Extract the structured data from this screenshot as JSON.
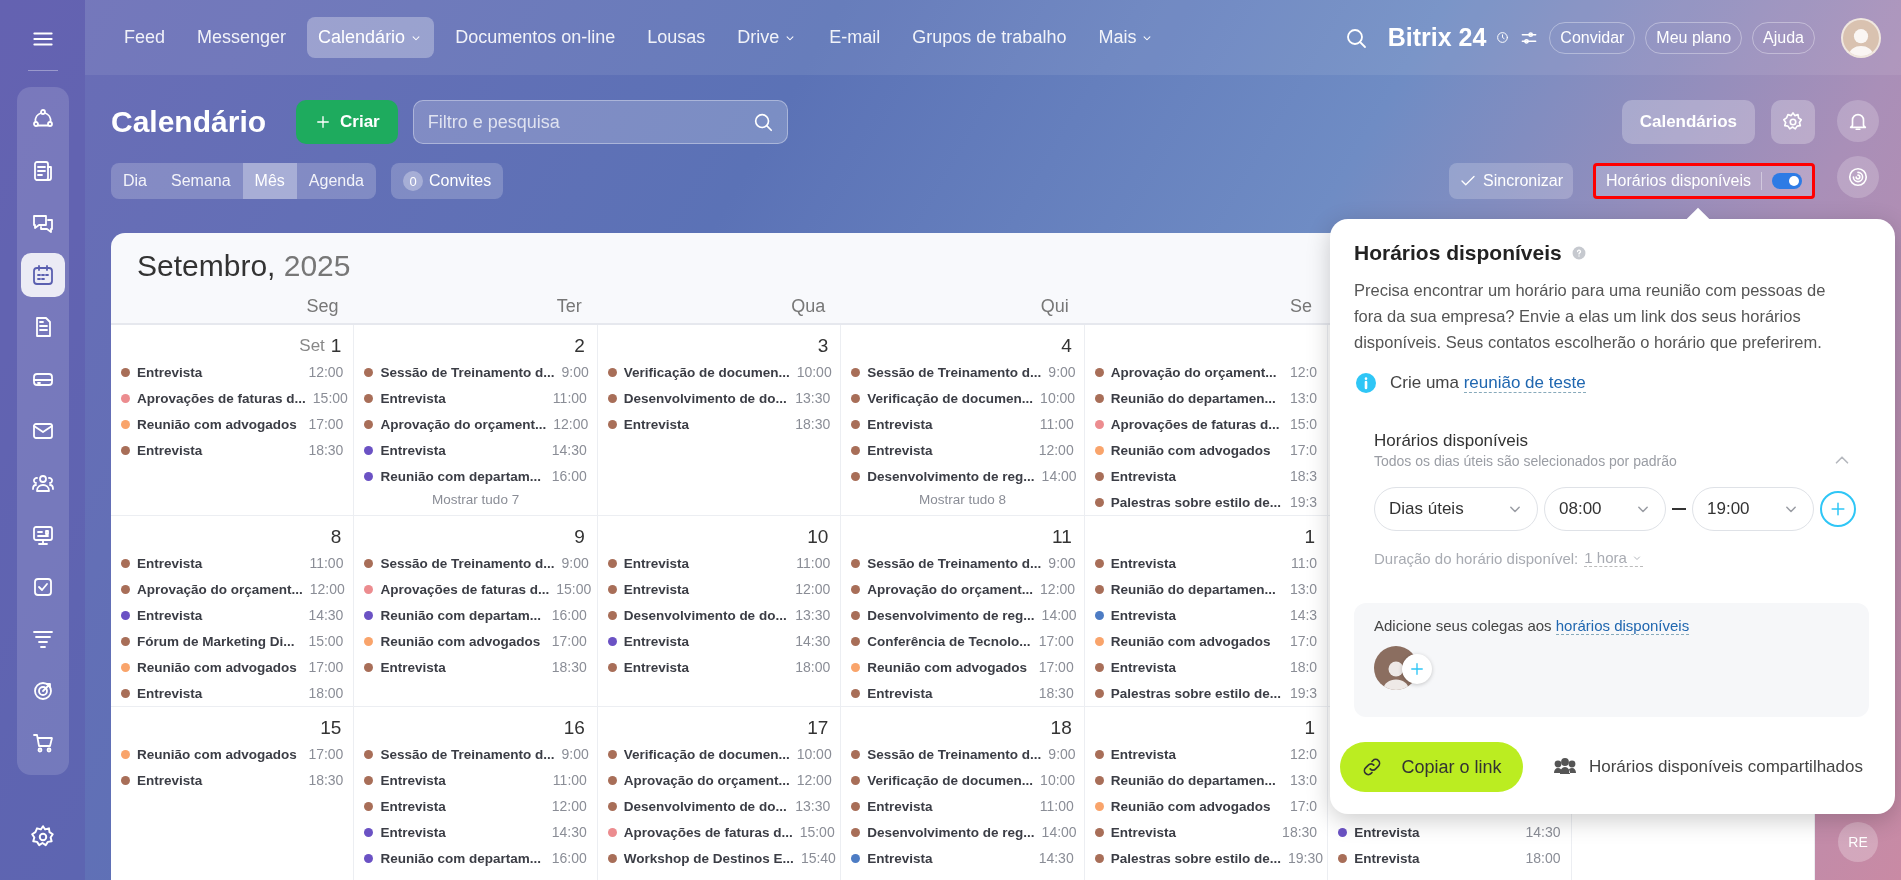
{
  "sidebar": {
    "items": [
      {
        "selected": false
      },
      {
        "selected": false
      },
      {
        "selected": false
      },
      {
        "selected": true
      },
      {
        "selected": false
      },
      {
        "selected": false
      },
      {
        "selected": false
      },
      {
        "selected": false
      },
      {
        "selected": false
      },
      {
        "selected": false
      },
      {
        "selected": false
      },
      {
        "selected": false
      },
      {
        "selected": false
      }
    ]
  },
  "nav": [
    {
      "label": "Feed",
      "selected": false,
      "dropdown": false
    },
    {
      "label": "Messenger",
      "selected": false,
      "dropdown": false
    },
    {
      "label": "Calendário",
      "selected": true,
      "dropdown": true
    },
    {
      "label": "Documentos on-line",
      "selected": false,
      "dropdown": false
    },
    {
      "label": "Lousas",
      "selected": false,
      "dropdown": false
    },
    {
      "label": "Drive",
      "selected": false,
      "dropdown": true
    },
    {
      "label": "E-mail",
      "selected": false,
      "dropdown": false
    },
    {
      "label": "Grupos de trabalho",
      "selected": false,
      "dropdown": false
    },
    {
      "label": "Mais",
      "selected": false,
      "dropdown": true
    }
  ],
  "topbar": {
    "logo": "Bitrix 24",
    "buttons": [
      "Convidar",
      "Meu plano",
      "Ajuda"
    ]
  },
  "page": {
    "title": "Calendário",
    "create": "Criar",
    "search_placeholder": "Filtro e pesquisa",
    "calendars_button": "Calendários"
  },
  "views": [
    {
      "label": "Dia",
      "selected": false
    },
    {
      "label": "Semana",
      "selected": false
    },
    {
      "label": "Mês",
      "selected": true
    },
    {
      "label": "Agenda",
      "selected": false
    }
  ],
  "invites": {
    "count": "0",
    "label": "Convites"
  },
  "sync": "Sincronizar",
  "availability_toggle": {
    "label": "Horários disponíveis",
    "on": true,
    "highlighted": true
  },
  "calendar": {
    "month": "Setembro,",
    "year": "2025",
    "weekdays": [
      "Seg",
      "Ter",
      "Qua",
      "Qui",
      "Se"
    ],
    "weeks": [
      {
        "days": [
          {
            "month_label": "Set",
            "day": "1",
            "events": [
              {
                "title": "Entrevista",
                "time": "12:00",
                "color": "#a86e58"
              },
              {
                "title": "Aprovações de faturas d...",
                "time": "15:00",
                "color": "#ec8c8f"
              },
              {
                "title": "Reunião com advogados",
                "time": "17:00",
                "color": "#f9a46b"
              },
              {
                "title": "Entrevista",
                "time": "18:30",
                "color": "#a86e58"
              }
            ]
          },
          {
            "day": "2",
            "events": [
              {
                "title": "Sessão de Treinamento d...",
                "time": "9:00",
                "color": "#a86e58"
              },
              {
                "title": "Entrevista",
                "time": "11:00",
                "color": "#a86e58"
              },
              {
                "title": "Aprovação do orçament...",
                "time": "12:00",
                "color": "#a86e58"
              },
              {
                "title": "Entrevista",
                "time": "14:30",
                "color": "#6b52c4"
              },
              {
                "title": "Reunião com departam...",
                "time": "16:00",
                "color": "#6b52c4"
              }
            ],
            "more": "Mostrar tudo 7"
          },
          {
            "day": "3",
            "events": [
              {
                "title": "Verificação de documen...",
                "time": "10:00",
                "color": "#a86e58"
              },
              {
                "title": "Desenvolvimento de do...",
                "time": "13:30",
                "color": "#a86e58"
              },
              {
                "title": "Entrevista",
                "time": "18:30",
                "color": "#a86e58"
              }
            ]
          },
          {
            "day": "4",
            "events": [
              {
                "title": "Sessão de Treinamento d...",
                "time": "9:00",
                "color": "#a86e58"
              },
              {
                "title": "Verificação de documen...",
                "time": "10:00",
                "color": "#a86e58"
              },
              {
                "title": "Entrevista",
                "time": "11:00",
                "color": "#a86e58"
              },
              {
                "title": "Entrevista",
                "time": "12:00",
                "color": "#a86e58"
              },
              {
                "title": "Desenvolvimento de reg...",
                "time": "14:00",
                "color": "#a86e58"
              }
            ],
            "more": "Mostrar tudo 8"
          },
          {
            "events": [
              {
                "title": "Aprovação do orçament...",
                "time": "12:0",
                "color": "#a86e58"
              },
              {
                "title": "Reunião do departamen...",
                "time": "13:0",
                "color": "#a86e58"
              },
              {
                "title": "Aprovações de faturas d...",
                "time": "15:0",
                "color": "#ec8c8f"
              },
              {
                "title": "Reunião com advogados",
                "time": "17:0",
                "color": "#f9a46b"
              },
              {
                "title": "Entrevista",
                "time": "18:3",
                "color": "#a86e58"
              },
              {
                "title": "Palestras sobre estilo de...",
                "time": "19:3",
                "color": "#a86e58"
              }
            ]
          }
        ]
      },
      {
        "days": [
          {
            "day": "8",
            "events": [
              {
                "title": "Entrevista",
                "time": "11:00",
                "color": "#a86e58"
              },
              {
                "title": "Aprovação do orçament...",
                "time": "12:00",
                "color": "#a86e58"
              },
              {
                "title": "Entrevista",
                "time": "14:30",
                "color": "#6b52c4"
              },
              {
                "title": "Fórum de Marketing Di...",
                "time": "15:00",
                "color": "#a86e58"
              },
              {
                "title": "Reunião com advogados",
                "time": "17:00",
                "color": "#f9a46b"
              },
              {
                "title": "Entrevista",
                "time": "18:00",
                "color": "#a86e58"
              }
            ]
          },
          {
            "day": "9",
            "events": [
              {
                "title": "Sessão de Treinamento d...",
                "time": "9:00",
                "color": "#a86e58"
              },
              {
                "title": "Aprovações de faturas d...",
                "time": "15:00",
                "color": "#ec8c8f"
              },
              {
                "title": "Reunião com departam...",
                "time": "16:00",
                "color": "#6b52c4"
              },
              {
                "title": "Reunião com advogados",
                "time": "17:00",
                "color": "#f9a46b"
              },
              {
                "title": "Entrevista",
                "time": "18:30",
                "color": "#a86e58"
              }
            ]
          },
          {
            "day": "10",
            "events": [
              {
                "title": "Entrevista",
                "time": "11:00",
                "color": "#a86e58"
              },
              {
                "title": "Entrevista",
                "time": "12:00",
                "color": "#a86e58"
              },
              {
                "title": "Desenvolvimento de do...",
                "time": "13:30",
                "color": "#a86e58"
              },
              {
                "title": "Entrevista",
                "time": "14:30",
                "color": "#6b52c4"
              },
              {
                "title": "Entrevista",
                "time": "18:00",
                "color": "#a86e58"
              }
            ]
          },
          {
            "day": "11",
            "events": [
              {
                "title": "Sessão de Treinamento d...",
                "time": "9:00",
                "color": "#a86e58"
              },
              {
                "title": "Aprovação do orçament...",
                "time": "12:00",
                "color": "#a86e58"
              },
              {
                "title": "Desenvolvimento de reg...",
                "time": "14:00",
                "color": "#a86e58"
              },
              {
                "title": "Conferência de Tecnolo...",
                "time": "17:00",
                "color": "#a86e58"
              },
              {
                "title": "Reunião com advogados",
                "time": "17:00",
                "color": "#f9a46b"
              },
              {
                "title": "Entrevista",
                "time": "18:30",
                "color": "#a86e58"
              }
            ]
          },
          {
            "day": "1",
            "events": [
              {
                "title": "Entrevista",
                "time": "11:0",
                "color": "#a86e58"
              },
              {
                "title": "Reunião do departamen...",
                "time": "13:0",
                "color": "#a86e58"
              },
              {
                "title": "Entrevista",
                "time": "14:3",
                "color": "#4d7cc4"
              },
              {
                "title": "Reunião com advogados",
                "time": "17:0",
                "color": "#f9a46b"
              },
              {
                "title": "Entrevista",
                "time": "18:0",
                "color": "#a86e58"
              },
              {
                "title": "Palestras sobre estilo de...",
                "time": "19:3",
                "color": "#a86e58"
              }
            ]
          }
        ]
      },
      {
        "days": [
          {
            "day": "15",
            "events": [
              {
                "title": "Reunião com advogados",
                "time": "17:00",
                "color": "#f9a46b"
              },
              {
                "title": "Entrevista",
                "time": "18:30",
                "color": "#a86e58"
              }
            ]
          },
          {
            "day": "16",
            "events": [
              {
                "title": "Sessão de Treinamento d...",
                "time": "9:00",
                "color": "#a86e58"
              },
              {
                "title": "Entrevista",
                "time": "11:00",
                "color": "#a86e58"
              },
              {
                "title": "Entrevista",
                "time": "12:00",
                "color": "#a86e58"
              },
              {
                "title": "Entrevista",
                "time": "14:30",
                "color": "#6b52c4"
              },
              {
                "title": "Reunião com departam...",
                "time": "16:00",
                "color": "#6b52c4"
              }
            ]
          },
          {
            "day": "17",
            "events": [
              {
                "title": "Verificação de documen...",
                "time": "10:00",
                "color": "#a86e58"
              },
              {
                "title": "Aprovação do orçament...",
                "time": "12:00",
                "color": "#a86e58"
              },
              {
                "title": "Desenvolvimento de do...",
                "time": "13:30",
                "color": "#a86e58"
              },
              {
                "title": "Aprovações de faturas d...",
                "time": "15:00",
                "color": "#ec8c8f"
              },
              {
                "title": "Workshop de Destinos E...",
                "time": "15:40",
                "color": "#a86e58"
              }
            ]
          },
          {
            "day": "18",
            "events": [
              {
                "title": "Sessão de Treinamento d...",
                "time": "9:00",
                "color": "#a86e58"
              },
              {
                "title": "Verificação de documen...",
                "time": "10:00",
                "color": "#a86e58"
              },
              {
                "title": "Entrevista",
                "time": "11:00",
                "color": "#a86e58"
              },
              {
                "title": "Desenvolvimento de reg...",
                "time": "14:00",
                "color": "#a86e58"
              },
              {
                "title": "Entrevista",
                "time": "14:30",
                "color": "#4d7cc4"
              }
            ]
          },
          {
            "day": "1",
            "events": [
              {
                "title": "Entrevista",
                "time": "12:0",
                "color": "#a86e58"
              },
              {
                "title": "Reunião do departamen...",
                "time": "13:0",
                "color": "#a86e58"
              },
              {
                "title": "Reunião com advogados",
                "time": "17:0",
                "color": "#f9a46b"
              },
              {
                "title": "Entrevista",
                "time": "18:30",
                "color": "#a86e58"
              },
              {
                "title": "Palestras sobre estilo de...",
                "time": "19:30",
                "color": "#a86e58"
              }
            ]
          },
          {
            "covered_top": true,
            "events": [
              {
                "title": "Entrevista",
                "time": "14:30",
                "color": "#6b52c4"
              },
              {
                "title": "Entrevista",
                "time": "18:00",
                "color": "#a86e58"
              }
            ]
          }
        ]
      }
    ]
  },
  "popup": {
    "title": "Horários disponíveis",
    "intro": "Precisa encontrar um horário para uma reunião com pessoas de fora da sua empresa? Envie a elas um link dos seus horários disponíveis. Seus contatos escolherão o horário que preferirem.",
    "info_prefix": "Crie uma",
    "info_link": "reunião de teste",
    "section": {
      "title": "Horários disponíveis",
      "subtitle": "Todos os dias úteis são selecionados por padrão",
      "expanded": true,
      "days": "Dias úteis",
      "from": "08:00",
      "to": "19:00",
      "duration_label": "Duração do horário disponível:",
      "duration": "1 hora"
    },
    "colleagues": {
      "text": "Adicione seus colegas aos",
      "link": "horários disponíveis"
    },
    "copy_button": "Copiar o link",
    "shared": "Horários disponíveis compartilhados"
  },
  "right_rail": {
    "badge": "RE"
  }
}
